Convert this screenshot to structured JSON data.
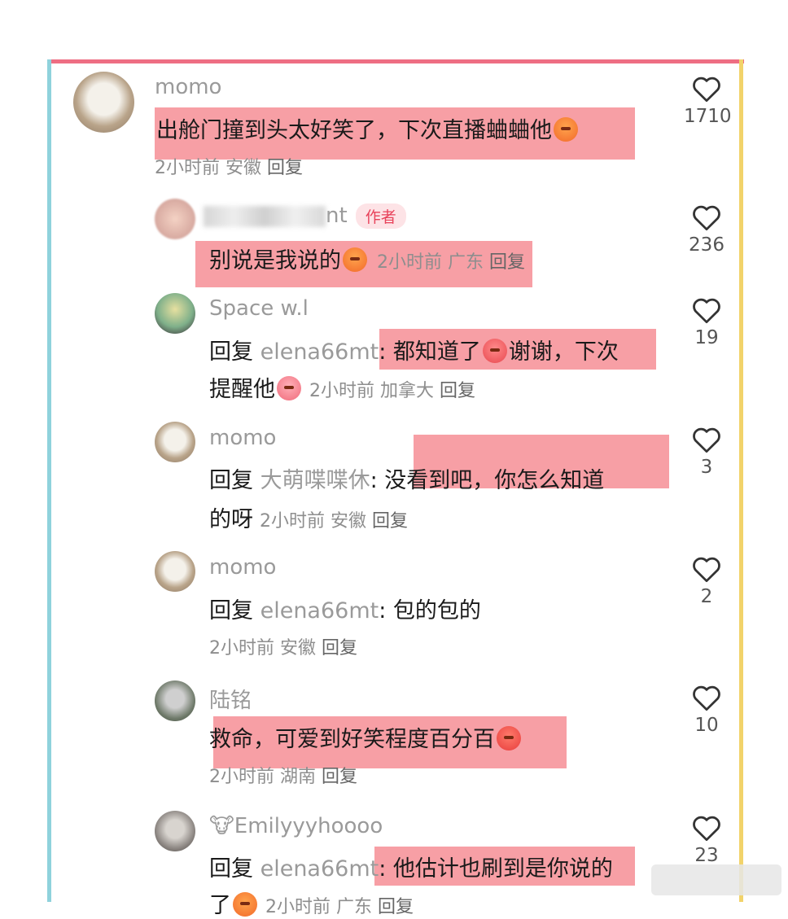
{
  "comments": [
    {
      "user": "momo",
      "text": "出舱门撞到头太好笑了，下次直播蛐蛐他",
      "time": "2小时前",
      "region": "安徽",
      "reply": "回复",
      "likes": "1710"
    },
    {
      "user_suffix": "nt",
      "badge": "作者",
      "text": "别说是我说的",
      "time": "2小时前",
      "region": "广东",
      "reply": "回复",
      "likes": "236"
    },
    {
      "user": "Space w.l",
      "reply_prefix": "回复",
      "reply_to": "elena66mt",
      "text_line1": "都知道了",
      "text_line1b": "谢谢，下次",
      "text_line2": "提醒他",
      "time": "2小时前",
      "region": "加拿大",
      "reply": "回复",
      "likes": "19"
    },
    {
      "user": "momo",
      "reply_prefix": "回复",
      "reply_to": "大萌喋喋休",
      "text_line1": "没看到吧，你怎么知道",
      "text_line2": "的呀",
      "time": "2小时前",
      "region": "安徽",
      "reply": "回复",
      "likes": "3"
    },
    {
      "user": "momo",
      "reply_prefix": "回复",
      "reply_to": "elena66mt",
      "text_line1": "包的包的",
      "time": "2小时前",
      "region": "安徽",
      "reply": "回复",
      "likes": "2"
    },
    {
      "user": "陆铭",
      "text": "救命，可爱到好笑程度百分百",
      "time": "2小时前",
      "region": "湖南",
      "reply": "回复",
      "likes": "10"
    },
    {
      "user": "Emilyyyhoooo",
      "reply_prefix": "回复",
      "reply_to": "elena66mt",
      "text_line1": "他估计也刷到是你说的",
      "text_line2": "了",
      "time": "2小时前",
      "region": "广东",
      "reply": "回复",
      "likes": "23"
    }
  ],
  "colors": {
    "highlight": "#f47a82",
    "frame_top": "#ee6e83",
    "frame_left": "#8fd2dc",
    "frame_right": "#f2d36a"
  },
  "icons": {
    "like": "heart-outline-icon"
  }
}
